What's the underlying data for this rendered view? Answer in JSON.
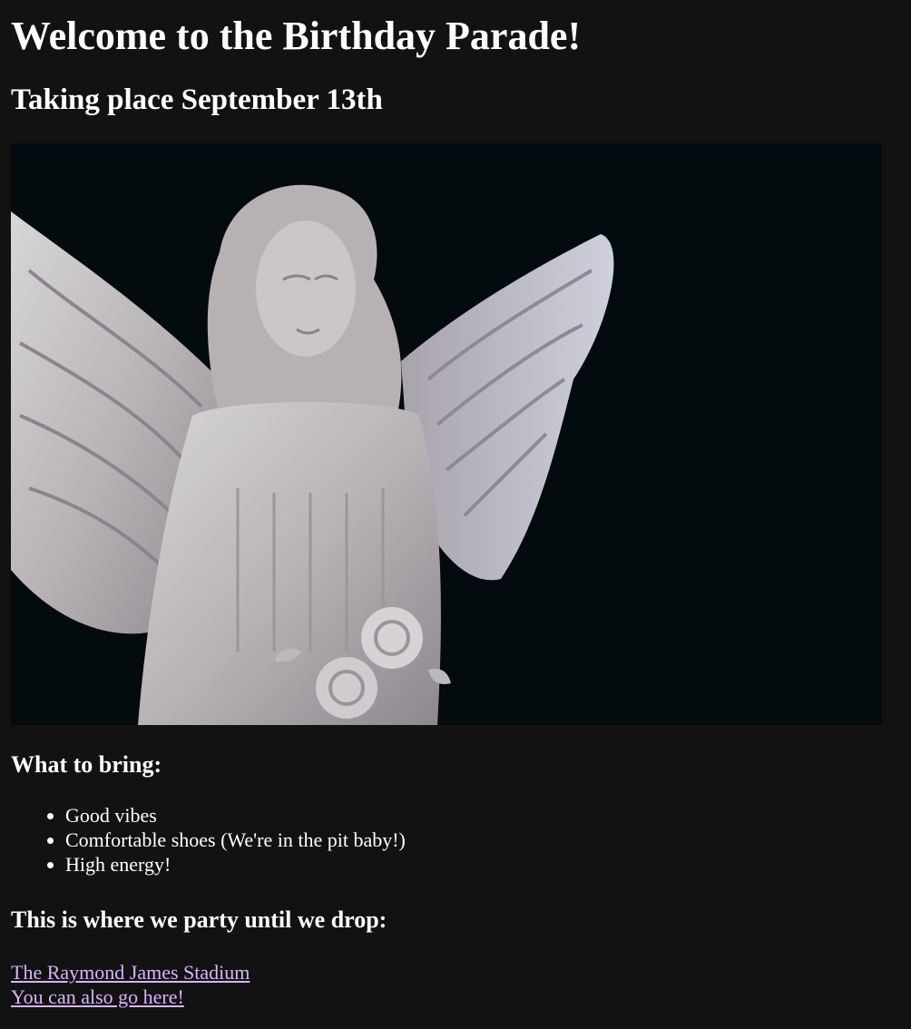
{
  "page": {
    "title": "Welcome to the Birthday Parade!",
    "subtitle": "Taking place September 13th"
  },
  "hero": {
    "alt": "Angel statue",
    "background": "#030b0f"
  },
  "bring": {
    "heading": "What to bring:",
    "items": [
      "Good vibes",
      "Comfortable shoes (We're in the pit baby!)",
      "High energy!"
    ]
  },
  "party": {
    "heading": "This is where we party until we drop:",
    "links": [
      "The Raymond James Stadium",
      "You can also go here!"
    ]
  },
  "colors": {
    "background": "#121212",
    "text": "#ffffff",
    "link": "#d9b3ff"
  }
}
